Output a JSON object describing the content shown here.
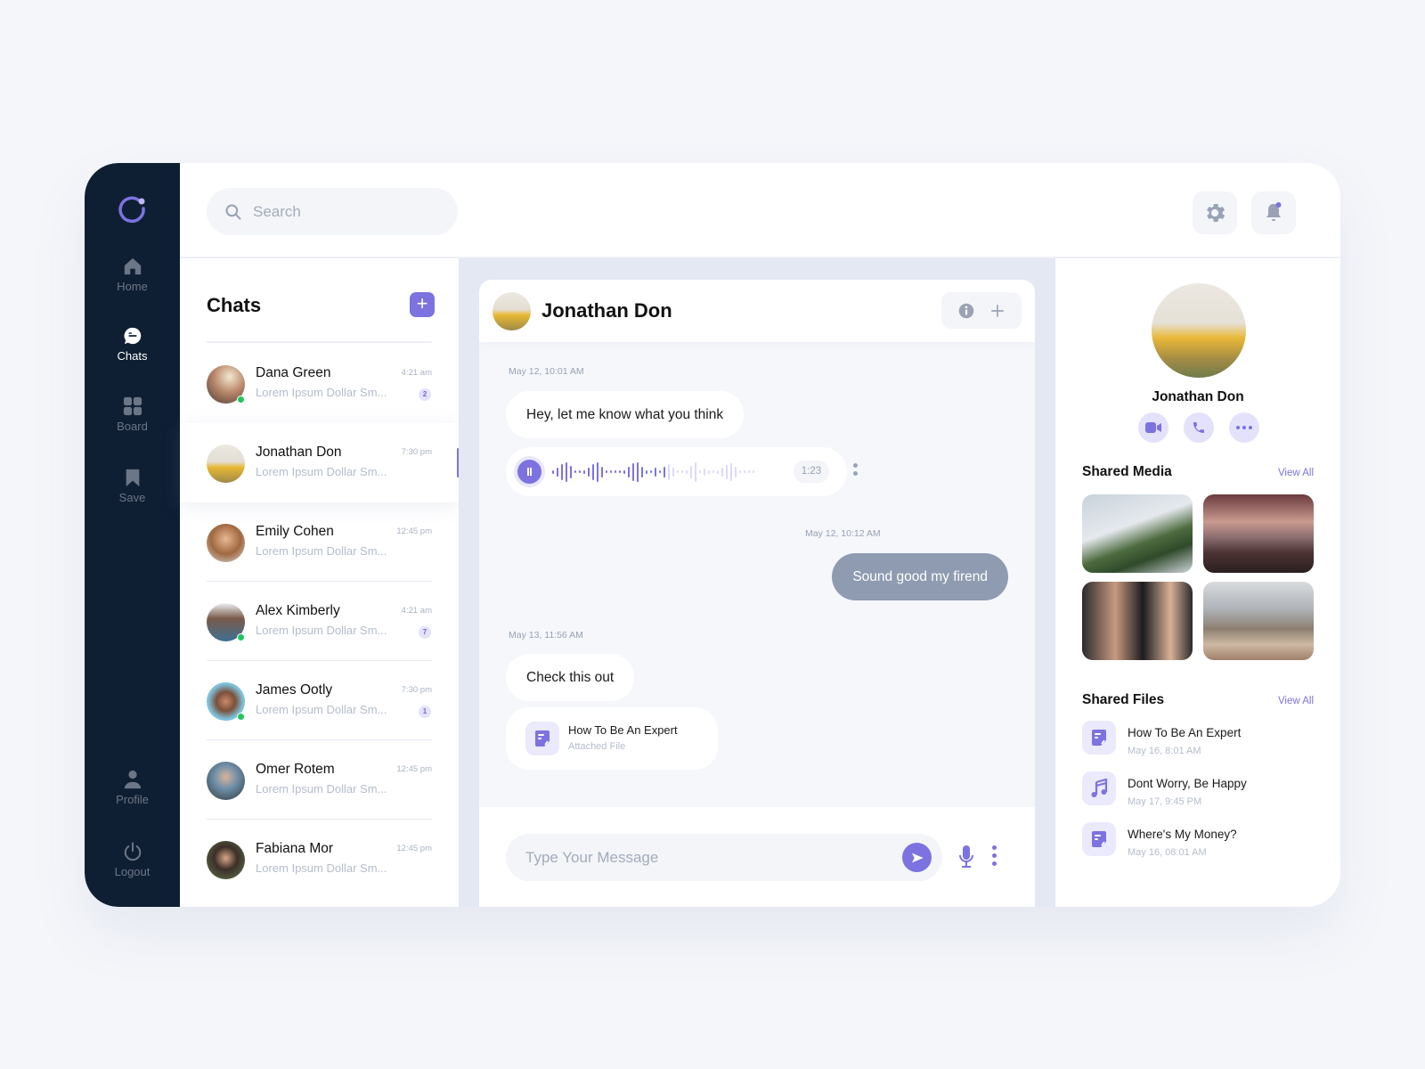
{
  "nav": {
    "items": [
      {
        "label": "Home",
        "icon": "home-icon",
        "active": false
      },
      {
        "label": "Chats",
        "icon": "chat-icon",
        "active": true
      },
      {
        "label": "Board",
        "icon": "grid-icon",
        "active": false
      },
      {
        "label": "Save",
        "icon": "bookmark-icon",
        "active": false
      }
    ],
    "bottom_items": [
      {
        "label": "Profile",
        "icon": "user-icon"
      },
      {
        "label": "Logout",
        "icon": "power-icon"
      }
    ]
  },
  "topbar": {
    "search_placeholder": "Search",
    "settings_icon": "gear-icon",
    "notifications_icon": "bell-icon",
    "has_unread_notification": true
  },
  "chat_list": {
    "title": "Chats",
    "add_label": "+",
    "chats": [
      {
        "name": "Dana Green",
        "preview": "Lorem Ipsum Dollar Sm...",
        "time": "4:21 am",
        "badge": "2",
        "online": true
      },
      {
        "name": "Jonathan Don",
        "preview": "Lorem Ipsum Dollar Sm...",
        "time": "7:30 pm",
        "badge": null,
        "online": false,
        "active": true
      },
      {
        "name": "Emily Cohen",
        "preview": "Lorem Ipsum Dollar Sm...",
        "time": "12:45 pm",
        "badge": null,
        "online": false
      },
      {
        "name": "Alex Kimberly",
        "preview": "Lorem Ipsum Dollar Sm...",
        "time": "4:21 am",
        "badge": "7",
        "online": true
      },
      {
        "name": "James Ootly",
        "preview": "Lorem Ipsum Dollar Sm...",
        "time": "7:30 pm",
        "badge": "1",
        "online": true
      },
      {
        "name": "Omer Rotem",
        "preview": "Lorem Ipsum Dollar Sm...",
        "time": "12:45 pm",
        "badge": null,
        "online": false
      },
      {
        "name": "Fabiana Mor",
        "preview": "Lorem Ipsum Dollar Sm...",
        "time": "12:45 pm",
        "badge": null,
        "online": false
      }
    ]
  },
  "conversation": {
    "contact_name": "Jonathan Don",
    "messages": [
      {
        "time": "May 12, 10:01 AM",
        "text": "Hey, let me know what you think",
        "direction": "in"
      },
      {
        "type": "voice",
        "duration": "1:23",
        "played_fraction": 0.55,
        "direction": "in"
      },
      {
        "time": "May 12, 10:12 AM",
        "text": "Sound good my firend",
        "direction": "out"
      },
      {
        "time": "May 13, 11:56 AM",
        "text": "Check this out",
        "direction": "in"
      },
      {
        "type": "file",
        "title": "How To Be An Expert",
        "subtitle": "Attached File",
        "direction": "in"
      }
    ],
    "input_placeholder": "Type Your Message"
  },
  "profile_panel": {
    "name": "Jonathan Don",
    "actions": [
      "video-icon",
      "phone-icon",
      "more-icon"
    ],
    "shared_media_title": "Shared Media",
    "shared_media_view_all": "View All",
    "media": [
      {
        "alt": "Palm trees by the sea"
      },
      {
        "alt": "Person with raised arms at sunset"
      },
      {
        "alt": "Group of smiling friends"
      },
      {
        "alt": "City skyline from a terrace"
      }
    ],
    "shared_files_title": "Shared Files",
    "shared_files_view_all": "View All",
    "files": [
      {
        "title": "How To Be An Expert",
        "date": "May 16, 8:01 AM",
        "icon": "document-icon"
      },
      {
        "title": "Dont Worry, Be Happy",
        "date": "May 17, 9:45 PM",
        "icon": "music-icon"
      },
      {
        "title": "Where's My Money?",
        "date": "May 16, 08:01 AM",
        "icon": "document-icon"
      }
    ]
  },
  "colors": {
    "accent": "#7c72e0",
    "nav_bg": "#0f1f33",
    "outgoing_bubble": "#8e9bb0",
    "online": "#22c55e"
  }
}
